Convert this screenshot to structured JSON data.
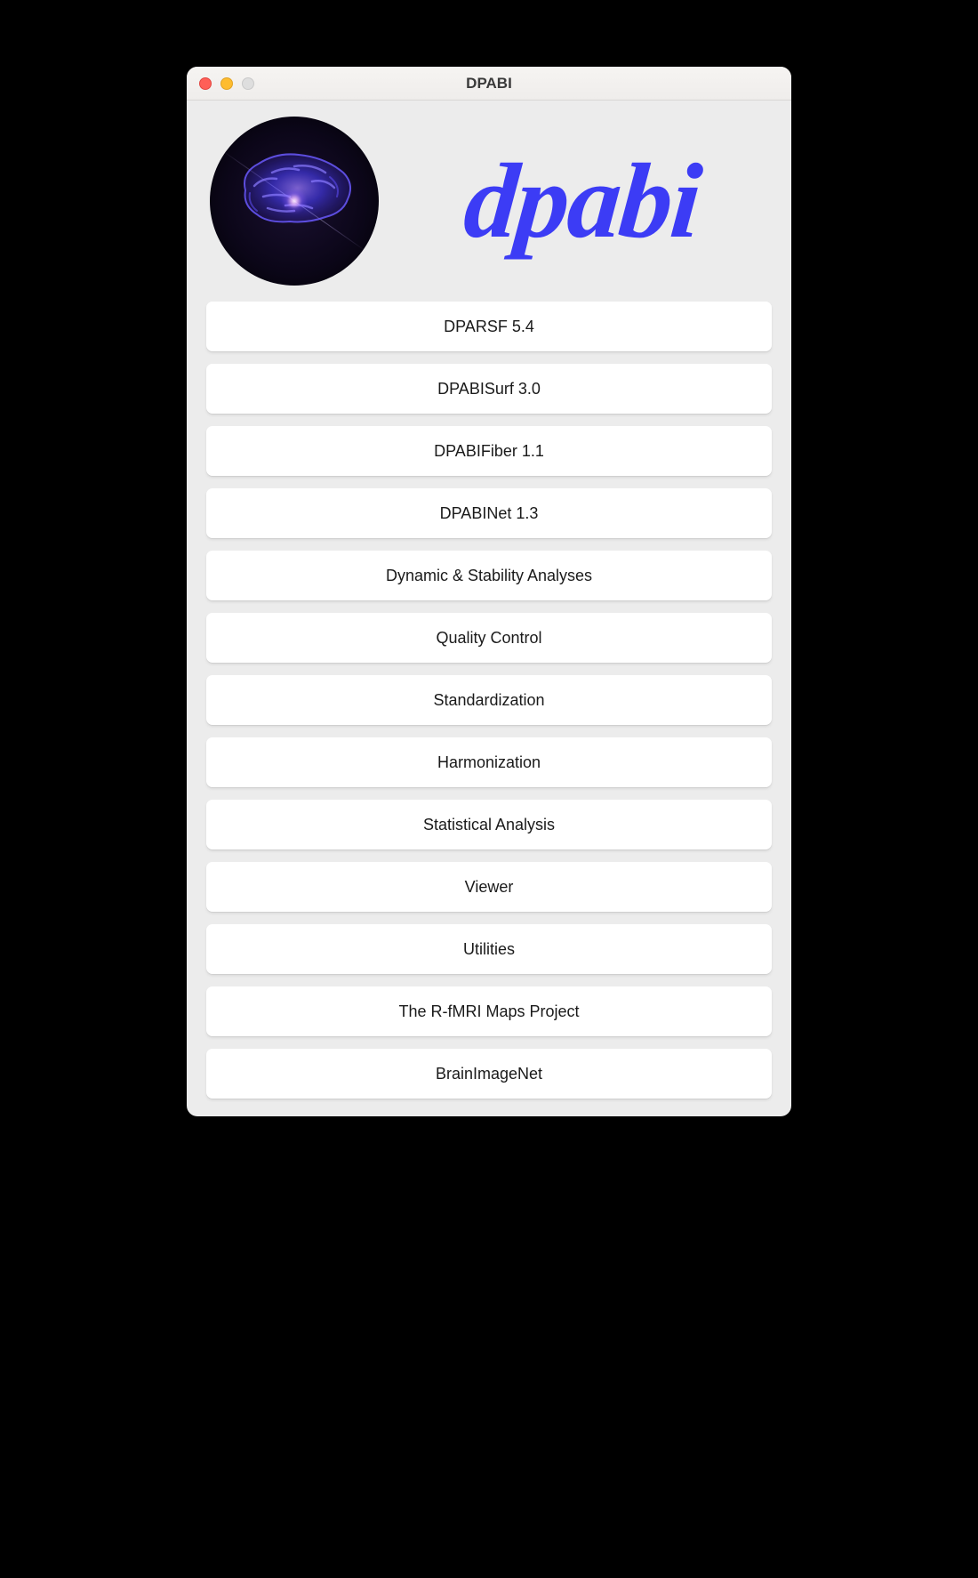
{
  "window": {
    "title": "DPABI"
  },
  "branding": {
    "wordmark": "dpabi",
    "logo_icon": "brain-icon"
  },
  "menu": {
    "buttons": [
      {
        "label": "DPARSF 5.4"
      },
      {
        "label": "DPABISurf 3.0"
      },
      {
        "label": "DPABIFiber 1.1"
      },
      {
        "label": "DPABINet 1.3"
      },
      {
        "label": "Dynamic & Stability Analyses"
      },
      {
        "label": "Quality Control"
      },
      {
        "label": "Standardization"
      },
      {
        "label": "Harmonization"
      },
      {
        "label": "Statistical Analysis"
      },
      {
        "label": "Viewer"
      },
      {
        "label": "Utilities"
      },
      {
        "label": "The R-fMRI Maps Project"
      },
      {
        "label": "BrainImageNet"
      }
    ]
  }
}
